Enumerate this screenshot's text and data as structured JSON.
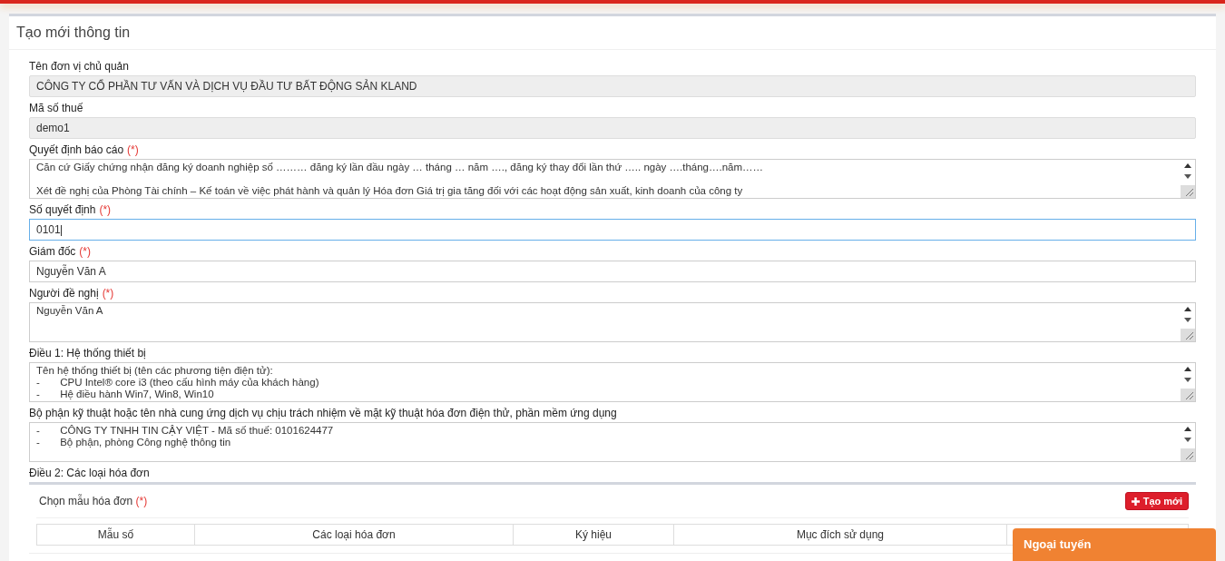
{
  "page_title": "Tạo mới thông tin",
  "fields": [
    {
      "label": "Tên đơn vị chủ quản",
      "kind": "readonly",
      "value": "CÔNG TY CỔ PHẦN TƯ VẤN VÀ DỊCH VỤ ĐẦU TƯ BẤT ĐỘNG SẢN KLAND"
    },
    {
      "label": "Mã số thuế",
      "kind": "readonly",
      "value": "demo1"
    },
    {
      "label": "Quyết định báo cáo",
      "required_mark": "(*)",
      "kind": "textarea",
      "paragraphs": [
        [
          "Căn cứ Giấy chứng nhận đăng ký doanh nghiệp số ……… đăng ký lần đầu ngày … tháng … năm …., đăng ký thay đổi lần thứ ….. ngày ….tháng….năm……"
        ],
        [
          "Xét đề nghị của Phòng Tài chính – Kế toán về việc phát hành và quản lý Hóa đơn Giá trị gia tăng đối với các hoạt động sản xuất, kinh doanh của công ty"
        ]
      ]
    },
    {
      "label": "Số quyết định",
      "required_mark": "(*)",
      "kind": "input",
      "value": "0101",
      "focused": true
    },
    {
      "label": "Giám đốc",
      "required_mark": "(*)",
      "kind": "input",
      "value": "Nguyễn Văn A",
      "focused": false
    },
    {
      "label": "Người đề nghị",
      "required_mark": "(*)",
      "kind": "textarea",
      "paragraphs": [
        [
          "Nguyễn Văn A"
        ]
      ]
    },
    {
      "label": "Điều 1: Hệ thống thiết bị",
      "kind": "textarea",
      "paragraphs": [
        [
          "Tên hệ thống thiết bị (tên các phương tiện điện tử):",
          "-       CPU Intel® core i3 (theo cấu hình máy của khách hàng)",
          "-       Hệ điều hành Win7, Win8, Win10"
        ]
      ]
    },
    {
      "label": "Bộ phận kỹ thuật hoặc tên nhà cung ứng dịch vụ chịu trách nhiệm về mặt kỹ thuật hóa đơn điện thử, phần mềm ứng dụng",
      "kind": "textarea",
      "paragraphs": [
        [
          "-       CÔNG TY TNHH TIN CẬY VIỆT - Mã số thuế: 0101624477",
          "-       Bộ phận, phòng Công nghệ thông tin"
        ]
      ]
    }
  ],
  "section": {
    "label": "Điều 2: Các loại hóa đơn",
    "select_label": "Chọn mẫu hóa đơn",
    "required_mark": "(*)",
    "create_button": "Tạo mới",
    "table": {
      "columns": [
        "Mẫu số",
        "Các loại hóa đơn",
        "Ký hiệu",
        "Mục đích sử dụng"
      ]
    }
  },
  "chat_widget": {
    "status": "Ngoại tuyến"
  }
}
